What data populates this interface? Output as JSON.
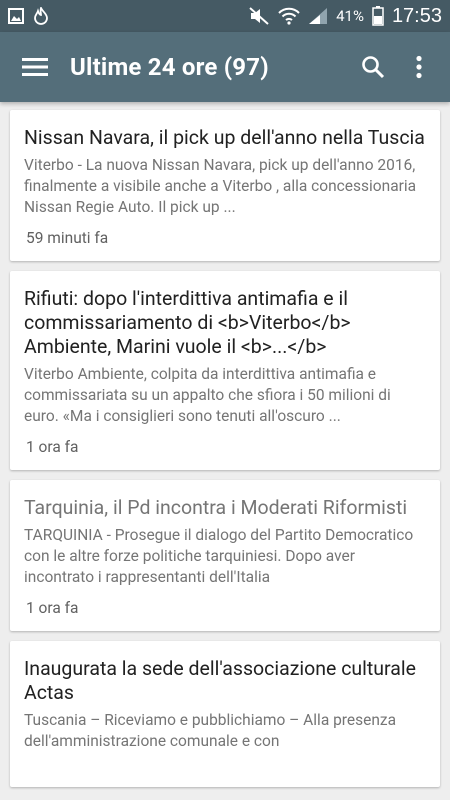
{
  "status_bar": {
    "battery": "41%",
    "time": "17:53"
  },
  "app_bar": {
    "title": "Ultime 24 ore (97)"
  },
  "articles": [
    {
      "title": "Nissan Navara, il pick up dell'anno nella Tuscia",
      "excerpt": "Viterbo - La nuova Nissan Navara, pick up dell'anno 2016, finalmente a visibile anche a Viterbo , alla concessionaria Nissan Regie Auto. Il pick up ...",
      "time": "59 minuti fa",
      "read": false
    },
    {
      "title": "Rifiuti: dopo l'interdittiva antimafia e il commissariamento di <b>Viterbo</b> Ambiente, Marini vuole il <b>...</b>",
      "excerpt": "Viterbo Ambiente, colpita da interdittiva antimafia e commissariata su un appalto che sfiora i 50 milioni di euro. «Ma i consiglieri sono tenuti all'oscuro ...",
      "time": "1 ora fa",
      "read": false
    },
    {
      "title": "Tarquinia, il Pd incontra i Moderati Riformisti",
      "excerpt": "TARQUINIA - Prosegue il dialogo del Partito Democratico con le altre forze politiche tarquiniesi. Dopo aver incontrato i rappresentanti dell'Italia",
      "time": "1 ora fa",
      "read": true
    },
    {
      "title": "Inaugurata la sede dell'associazione culturale Actas",
      "excerpt": "Tuscania – Riceviamo e pubblichiamo – Alla presenza dell'amministrazione comunale e con",
      "time": "",
      "read": false
    }
  ]
}
